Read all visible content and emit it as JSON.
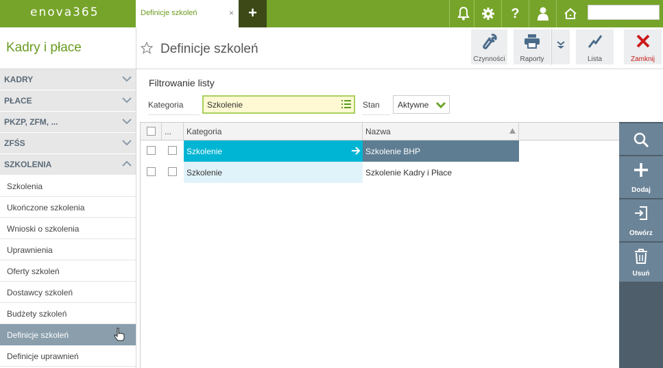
{
  "app": {
    "logo": "enova365"
  },
  "tabs": [
    {
      "label": "Definicje szkoleń",
      "close": "×"
    }
  ],
  "topbar": {
    "add_icon": "plus-icon",
    "icons": [
      "bell-icon",
      "gear-icon",
      "help-icon",
      "user-icon",
      "home-icon"
    ],
    "search_value": ""
  },
  "sidebar": {
    "module_title": "Kadry i płace",
    "sections": [
      {
        "label": "KADRY",
        "expanded": false
      },
      {
        "label": "PŁACE",
        "expanded": false
      },
      {
        "label": "PKZP, ZFM, ...",
        "expanded": false
      },
      {
        "label": "ZFŚS",
        "expanded": false
      },
      {
        "label": "SZKOLENIA",
        "expanded": true
      }
    ],
    "items": [
      {
        "label": "Szkolenia"
      },
      {
        "label": "Ukończone szkolenia"
      },
      {
        "label": "Wnioski o szkolenia"
      },
      {
        "label": "Uprawnienia"
      },
      {
        "label": "Oferty szkoleń"
      },
      {
        "label": "Dostawcy szkoleń"
      },
      {
        "label": "Budżety szkoleń"
      },
      {
        "label": "Definicje szkoleń",
        "selected": true
      },
      {
        "label": "Definicje uprawnień"
      }
    ]
  },
  "header": {
    "title": "Definicje szkoleń",
    "toolbar": {
      "czynnosci": "Czynności",
      "raporty": "Raporty",
      "lista": "Lista",
      "zamknij": "Zamknij"
    }
  },
  "filter": {
    "title": "Filtrowanie listy",
    "kategoria_label": "Kategoria",
    "kategoria_value": "Szkolenie",
    "stan_label": "Stan",
    "stan_value": "Aktywne"
  },
  "grid": {
    "columns": {
      "dots": "...",
      "kategoria": "Kategoria",
      "nazwa": "Nazwa"
    },
    "rows": [
      {
        "kategoria": "Szkolenie",
        "nazwa": "Szkolenie BHP",
        "selected": true
      },
      {
        "kategoria": "Szkolenie",
        "nazwa": "Szkolenie Kadry i Płace",
        "selected": false
      }
    ]
  },
  "actions": {
    "dodaj": "Dodaj",
    "otworz": "Otwórz",
    "usun": "Usuń"
  },
  "colors": {
    "brand_green": "#76a42a",
    "selected_row": "#00b5d3",
    "selected_row_name": "#5e7d92",
    "actionbar": "#6c8497",
    "close_red": "#cc1a1a"
  }
}
